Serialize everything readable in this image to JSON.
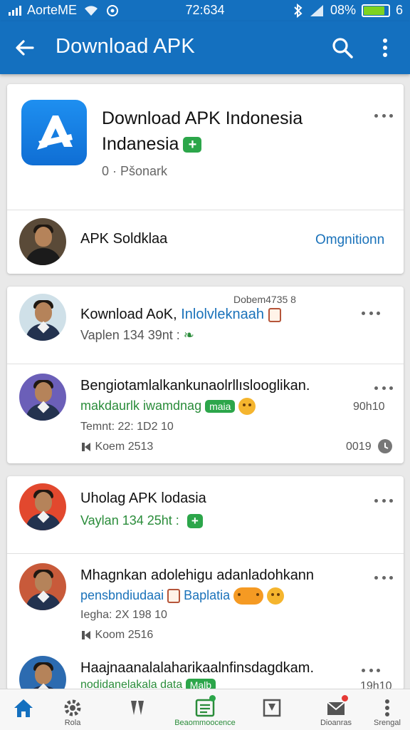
{
  "status_bar": {
    "carrier": "AorteME",
    "time": "72:634",
    "battery_percent": "08%",
    "battery_level": 0.85,
    "battery_tail": "6"
  },
  "app_bar": {
    "title": "Download APK",
    "back_icon": "arrow-left-icon",
    "search_icon": "search-icon",
    "more_icon": "more-vert-icon",
    "color": "#1470bf"
  },
  "header_card": {
    "app_name_line1": "Download APK Indonesia",
    "app_name_line2": "Indanesia",
    "meta": "0 · Pšonark",
    "publisher": "APK Soldklaa",
    "action_label": "Omgnitionn"
  },
  "posts_group_1": [
    {
      "title": "Kownload AoK,",
      "title_highlight": "Inlolvleknaah",
      "sub": "Vaplen 134 39nt :",
      "timestamp": "Dobem4735 8"
    },
    {
      "title": "Bengiotamlalkankunaolrllıslooglikan.",
      "sub": "makdaurlk iwamdnag",
      "tag": "maia",
      "date": "Temnt: 22: 1D2 10",
      "right_value": "90h10",
      "comments": "Koem 2513",
      "views": "0019"
    }
  ],
  "posts_group_2": [
    {
      "title": "Uholag APK lodasia",
      "sub": "Vaylan 134 25ht :"
    },
    {
      "title": "Mhagnkan adolehigu adanladohkann",
      "sub": "pensbndiudaai",
      "sub_highlight": "Baplatia",
      "date": "Iegha: 2X 198 10",
      "comments": "Koom 2516"
    },
    {
      "title": "Haajnaanalalaharikaalnfinsdagdkam.",
      "sub": "nodidanelakala data",
      "tag": "Malb",
      "right_value": "19h10"
    }
  ],
  "bottom_nav": [
    {
      "label": "",
      "icon": "home-icon"
    },
    {
      "label": "Rola",
      "icon": "gear-icon"
    },
    {
      "label": "",
      "icon": "bookmark-icon"
    },
    {
      "label": "Beaommoocence",
      "icon": "list-icon"
    },
    {
      "label": "",
      "icon": "share-icon"
    },
    {
      "label": "Dioanras",
      "icon": "mail-icon"
    },
    {
      "label": "Srengal",
      "icon": "more-vert-icon"
    }
  ]
}
